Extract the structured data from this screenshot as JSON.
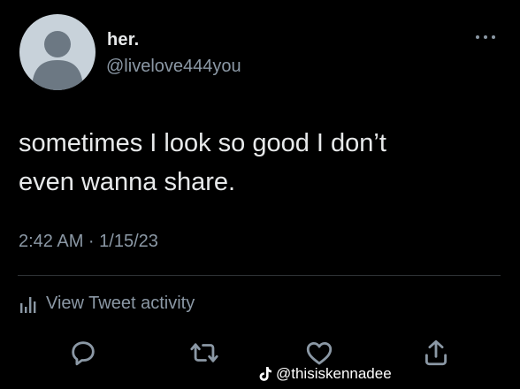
{
  "author": {
    "display_name": "her.",
    "handle": "@livelove444you",
    "avatar_icon": "default-avatar-icon"
  },
  "tweet": {
    "text_line1": "sometimes I look so good I don’t",
    "text_line2": "even wanna share.",
    "timestamp": "2:42 AM · 1/15/23"
  },
  "activity": {
    "label": "View Tweet activity",
    "icon": "analytics-bars-icon"
  },
  "actions": {
    "reply_icon": "reply-icon",
    "retweet_icon": "retweet-icon",
    "like_icon": "heart-icon",
    "share_icon": "share-icon"
  },
  "watermark": {
    "icon": "tiktok-icon",
    "text": "@thisiskennadee"
  },
  "colors": {
    "background": "#000000",
    "primary_text": "#e7e9ea",
    "secondary_text": "#8b98a5",
    "divider": "#2f3336",
    "avatar_bg": "#c8d2da",
    "avatar_silhouette": "#6c7883"
  }
}
